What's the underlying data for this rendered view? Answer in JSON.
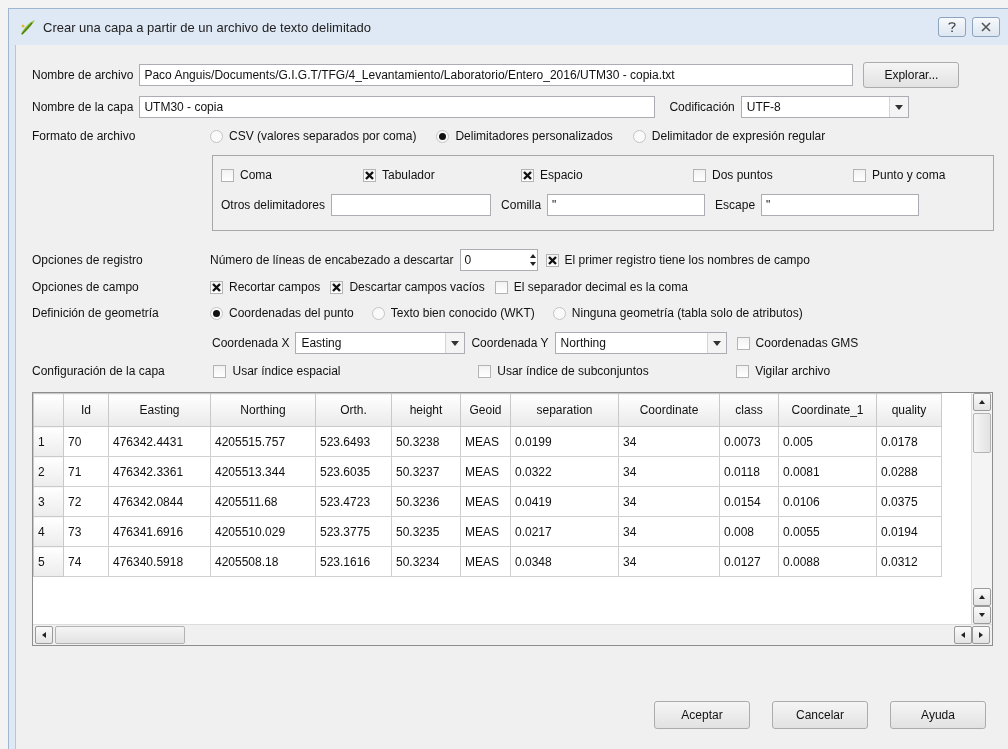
{
  "window": {
    "title": "Crear una capa a partir de un archivo de texto delimitado"
  },
  "file_name": {
    "label": "Nombre de archivo",
    "value": "Paco Anguis/Documents/G.I.G.T/TFG/4_Levantamiento/Laboratorio/Entero_2016/UTM30 - copia.txt",
    "button": "Explorar..."
  },
  "layer_name": {
    "label": "Nombre de la capa",
    "value": "UTM30 - copia"
  },
  "encoding": {
    "label": "Codificación",
    "value": "UTF-8"
  },
  "file_format": {
    "label": "Formato de archivo",
    "options": [
      {
        "label": "CSV (valores separados por coma)",
        "selected": false
      },
      {
        "label": "Delimitadores personalizados",
        "selected": true
      },
      {
        "label": "Delimitador de expresión regular",
        "selected": false
      }
    ]
  },
  "delimiters": {
    "checks": [
      {
        "label": "Coma",
        "checked": false
      },
      {
        "label": "Tabulador",
        "checked": true
      },
      {
        "label": "Espacio",
        "checked": true
      },
      {
        "label": "Dos puntos",
        "checked": false
      },
      {
        "label": "Punto y coma",
        "checked": false
      }
    ],
    "fields": [
      {
        "label": "Otros delimitadores"
      },
      {
        "label": "Comilla",
        "value": "\""
      },
      {
        "label": "Escape",
        "value": "\""
      }
    ]
  },
  "record_options": {
    "label": "Opciones de registro",
    "skip_label": "Número de líneas de encabezado a descartar",
    "skip_value": "0",
    "header_check": {
      "label": "El primer registro tiene los nombres de campo",
      "checked": true
    }
  },
  "field_options": {
    "label": "Opciones de campo",
    "checks": [
      {
        "label": "Recortar campos",
        "checked": true
      },
      {
        "label": "Descartar campos vacíos",
        "checked": true
      },
      {
        "label": "El separador decimal es la coma",
        "checked": false
      }
    ]
  },
  "geometry": {
    "label": "Definición de geometría",
    "options": [
      {
        "label": "Coordenadas del punto",
        "selected": true
      },
      {
        "label": "Texto bien conocido (WKT)",
        "selected": false
      },
      {
        "label": "Ninguna geometría (tabla solo de atributos)",
        "selected": false
      }
    ],
    "x_label": "Coordenada X",
    "x_value": "Easting",
    "y_label": "Coordenada Y",
    "y_value": "Northing",
    "dms": {
      "label": "Coordenadas GMS",
      "checked": false
    }
  },
  "layer_settings": {
    "label": "Configuración de la capa",
    "checks": [
      {
        "label": "Usar índice espacial",
        "checked": false
      },
      {
        "label": "Usar índice de subconjuntos",
        "checked": false
      },
      {
        "label": "Vigilar archivo",
        "checked": false
      }
    ]
  },
  "table": {
    "columns": [
      "Id",
      "Easting",
      "Northing",
      "Orth.",
      "height",
      "Geoid",
      "separation",
      "Coordinate",
      "class",
      "Coordinate_1",
      "quality"
    ],
    "rows": [
      {
        "number": "1",
        "cells": [
          "70",
          "476342.4431",
          "4205515.757",
          "523.6493",
          "50.3238",
          "MEAS",
          "0.0199",
          "34",
          "0.0073",
          "0.005",
          "0.0178"
        ]
      },
      {
        "number": "2",
        "cells": [
          "71",
          "476342.3361",
          "4205513.344",
          "523.6035",
          "50.3237",
          "MEAS",
          "0.0322",
          "34",
          "0.0118",
          "0.0081",
          "0.0288"
        ]
      },
      {
        "number": "3",
        "cells": [
          "72",
          "476342.0844",
          "4205511.68",
          "523.4723",
          "50.3236",
          "MEAS",
          "0.0419",
          "34",
          "0.0154",
          "0.0106",
          "0.0375"
        ]
      },
      {
        "number": "4",
        "cells": [
          "73",
          "476341.6916",
          "4205510.029",
          "523.3775",
          "50.3235",
          "MEAS",
          "0.0217",
          "34",
          "0.008",
          "0.0055",
          "0.0194"
        ]
      },
      {
        "number": "5",
        "cells": [
          "74",
          "476340.5918",
          "4205508.18",
          "523.1616",
          "50.3234",
          "MEAS",
          "0.0348",
          "34",
          "0.0127",
          "0.0088",
          "0.0312"
        ]
      }
    ]
  },
  "buttons": [
    {
      "label": "Aceptar"
    },
    {
      "label": "Cancelar"
    },
    {
      "label": "Ayuda"
    }
  ]
}
